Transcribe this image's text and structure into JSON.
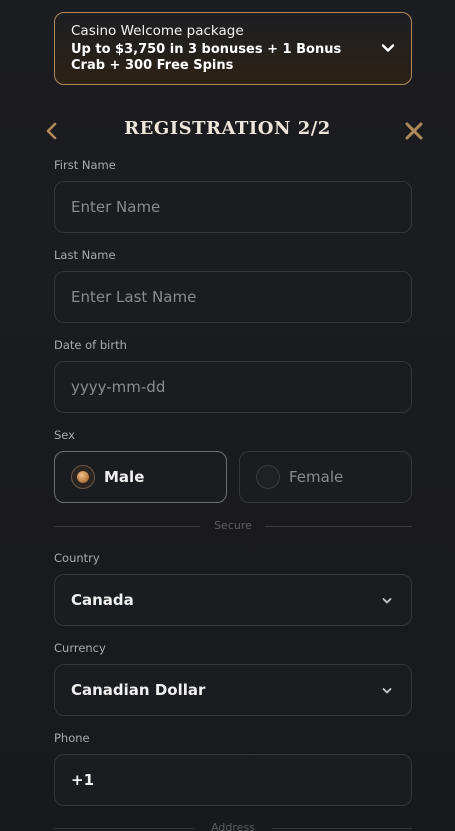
{
  "promo": {
    "title": "Casino Welcome package",
    "text": "Up to $3,750 in 3 bonuses + 1 Bonus Crab + 300 Free Spins"
  },
  "registration": {
    "title": "REGISTRATION 2/2"
  },
  "form": {
    "first_name": {
      "label": "First Name",
      "placeholder": "Enter Name"
    },
    "last_name": {
      "label": "Last Name",
      "placeholder": "Enter Last Name"
    },
    "dob": {
      "label": "Date of birth",
      "placeholder": "yyyy-mm-dd"
    },
    "sex": {
      "label": "Sex",
      "options": [
        "Male",
        "Female"
      ],
      "selected": "Male"
    },
    "secure_divider": "Secure",
    "country": {
      "label": "Country",
      "value": "Canada"
    },
    "currency": {
      "label": "Currency",
      "value": "Canadian Dollar"
    },
    "phone": {
      "label": "Phone",
      "value": "+1"
    },
    "address_divider": "Address"
  },
  "colors": {
    "accent": "#b0885a",
    "background": "#1a1b1e",
    "field_border": "#34363c"
  }
}
